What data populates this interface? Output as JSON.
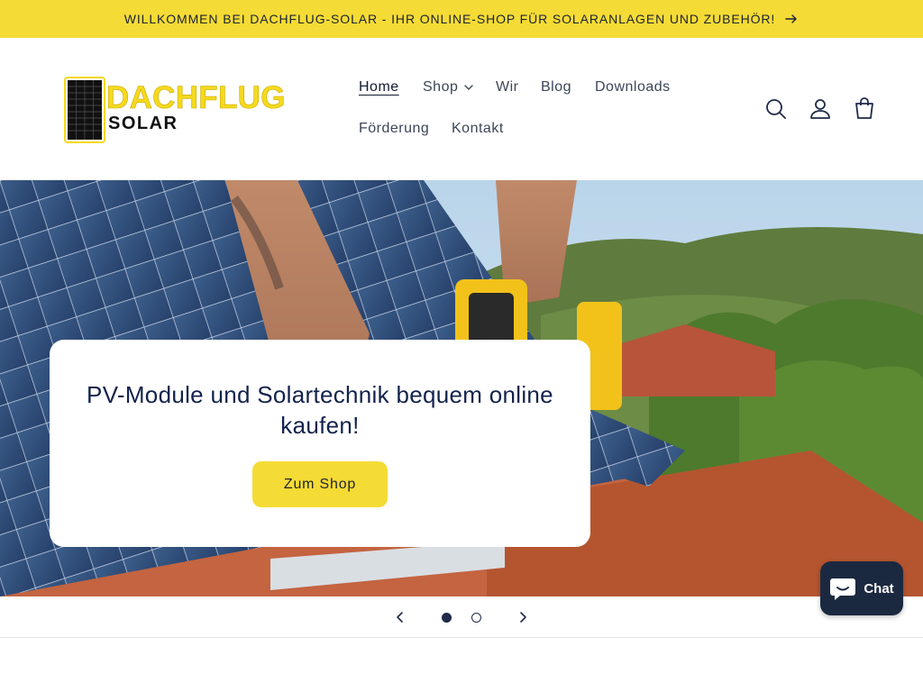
{
  "announcement": {
    "text": "WILLKOMMEN BEI DACHFLUG-SOLAR - IHR ONLINE-SHOP FÜR SOLARANLAGEN UND ZUBEHÖR!",
    "icon": "arrow-right-icon"
  },
  "logo": {
    "top_text": "DACHFLUG",
    "bottom_text": "SOLAR"
  },
  "nav": {
    "items": [
      {
        "label": "Home",
        "active": true
      },
      {
        "label": "Shop",
        "has_dropdown": true
      },
      {
        "label": "Wir"
      },
      {
        "label": "Blog"
      },
      {
        "label": "Downloads"
      },
      {
        "label": "Förderung"
      },
      {
        "label": "Kontakt"
      }
    ]
  },
  "header_icons": [
    "search-icon",
    "account-icon",
    "cart-icon"
  ],
  "hero": {
    "heading": "PV-Module und Solartechnik bequem online kaufen!",
    "button_label": "Zum Shop"
  },
  "slider": {
    "slide_count": 2,
    "active_slide": 1
  },
  "chat": {
    "label": "Chat"
  },
  "colors": {
    "accent_yellow": "#f5db35",
    "navy": "#1b2940",
    "text": "#1f2a4a"
  }
}
